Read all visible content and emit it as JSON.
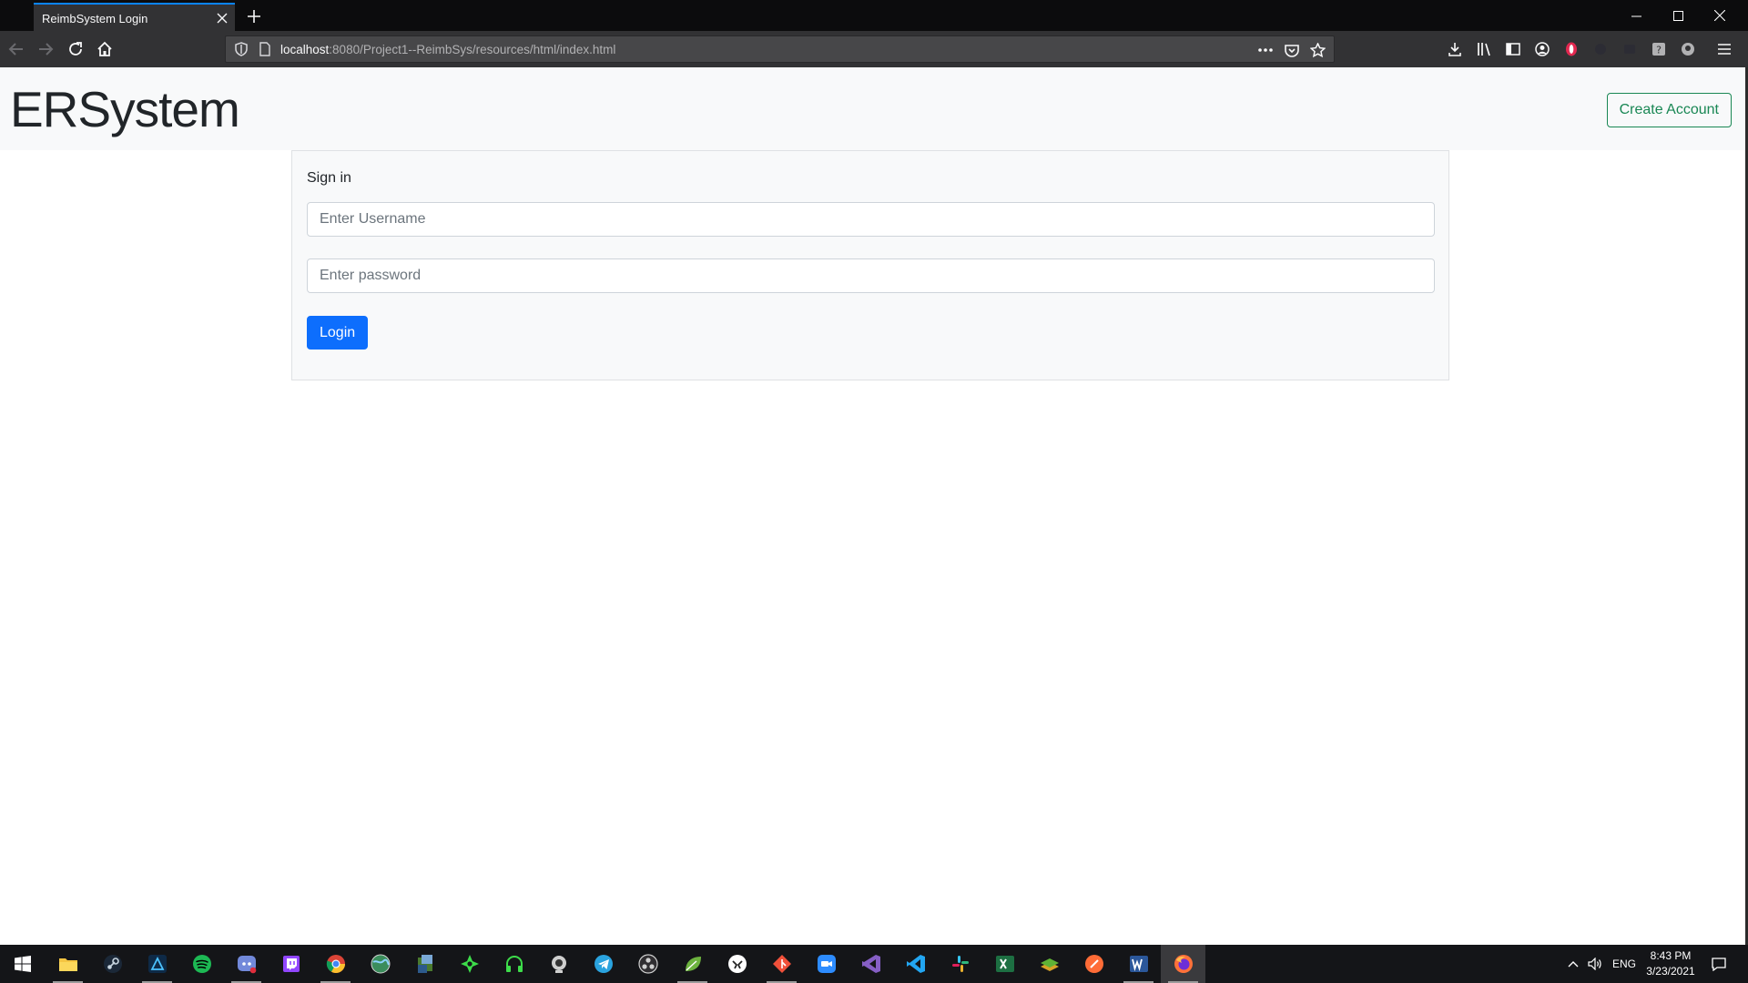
{
  "browser": {
    "tab_title": "ReimbSystem Login",
    "url_host": "localhost",
    "url_rest": ":8080/Project1--ReimbSys/resources/html/index.html",
    "accent": "#0a84ff"
  },
  "page": {
    "brand": "ERSystem",
    "create_account_label": "Create Account",
    "signin_title": "Sign in",
    "username_placeholder": "Enter Username",
    "password_placeholder": "Enter password",
    "login_label": "Login",
    "colors": {
      "primary": "#0d6efd",
      "success": "#198754",
      "navbar_bg": "#f8f9fa"
    }
  },
  "toolbar_icons": [
    "back-icon",
    "forward-icon",
    "reload-icon",
    "home-icon",
    "shield-icon",
    "page-icon",
    "more-icon",
    "pocket-icon",
    "bookmark-star-icon",
    "downloads-icon",
    "library-icon",
    "sidebar-icon",
    "account-icon",
    "extension-icon",
    "help-icon",
    "menu-icon"
  ],
  "taskbar": {
    "apps": [
      "file-explorer",
      "steam",
      "affinity",
      "spotify",
      "discord",
      "twitch",
      "chrome",
      "globe",
      "archive",
      "apex",
      "headphones",
      "webcam",
      "telegram",
      "obs",
      "leaf",
      "game",
      "git",
      "zoom",
      "visual-studio",
      "vscode",
      "slack",
      "excel",
      "layers",
      "postman",
      "word",
      "firefox"
    ],
    "lang": "ENG",
    "time": "8:43 PM",
    "date": "3/23/2021"
  }
}
